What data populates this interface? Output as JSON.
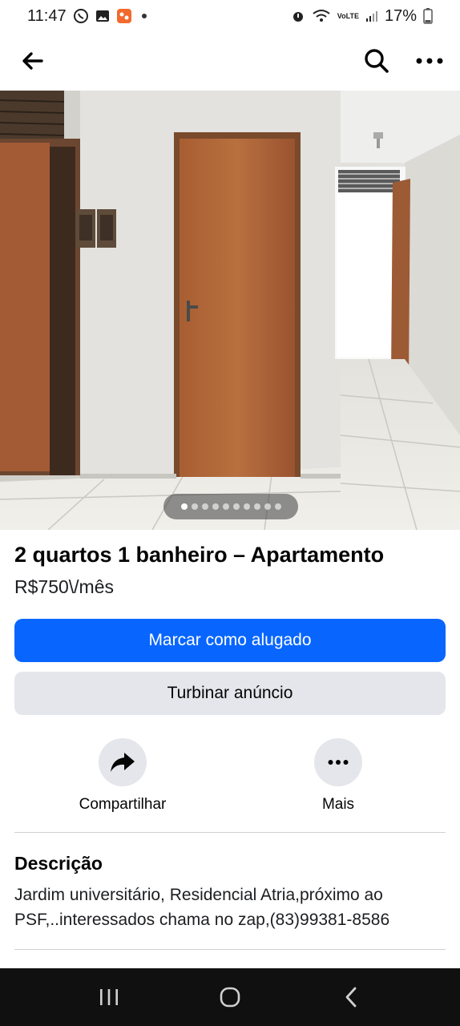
{
  "status_bar": {
    "time": "11:47",
    "battery": "17%",
    "network_label": "VoLTE"
  },
  "header": {
    "back_icon": "arrow-left-icon",
    "search_icon": "search-icon",
    "more_icon": "more-horizontal-icon"
  },
  "photo": {
    "page_count": 10,
    "active_page": 1
  },
  "listing": {
    "title": "2 quartos 1 banheiro – Apartamento",
    "price": "R$750\\/mês"
  },
  "buttons": {
    "mark_rented": "Marcar como alugado",
    "boost": "Turbinar anúncio"
  },
  "actions": {
    "share_label": "Compartilhar",
    "more_label": "Mais"
  },
  "description": {
    "heading": "Descrição",
    "text": "Jardim universitário, Residencial Atria,próximo ao PSF,..interessados chama no zap,(83)99381-8586"
  },
  "colors": {
    "primary": "#0866ff",
    "secondary_bg": "#e4e6eb",
    "nav_bar": "#101010"
  }
}
